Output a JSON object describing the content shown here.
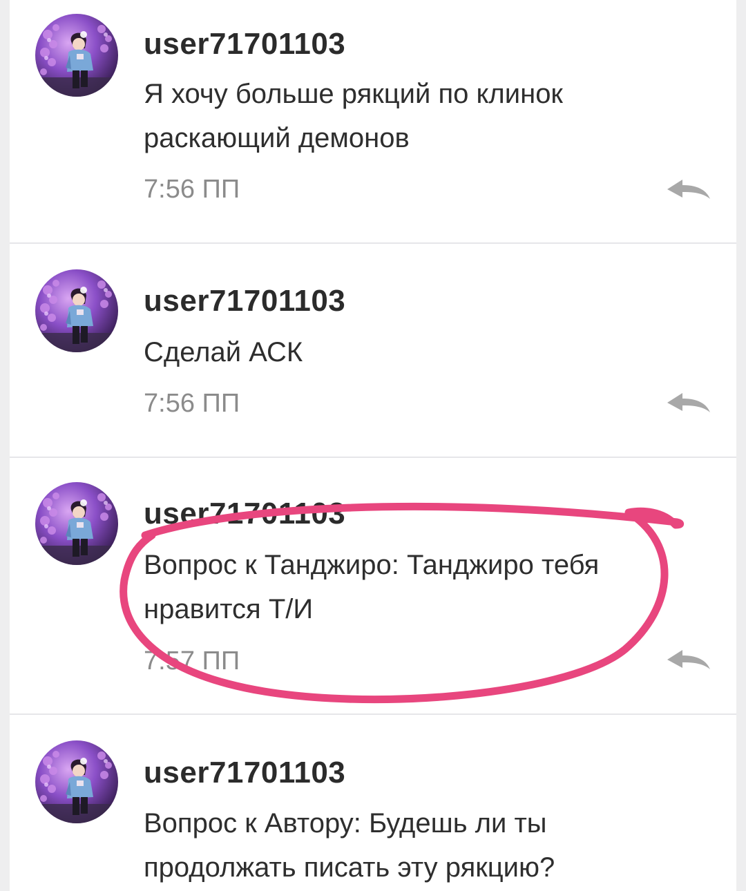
{
  "comments": [
    {
      "username": "user71701103",
      "text": "Я хочу больше рякций по клинок раскающий демонов",
      "time": "7:56 ПП"
    },
    {
      "username": "user71701103",
      "text": "Сделай АСК",
      "time": "7:56 ПП"
    },
    {
      "username": "user71701103",
      "text": "Вопрос к Танджиро: Танджиро тебя нравится Т/И",
      "time": "7:57 ПП"
    },
    {
      "username": "user71701103",
      "text": "Вопрос к Автору: Будешь ли ты продолжать писать эту рякцию?",
      "time": ""
    }
  ],
  "icons": {
    "avatar": "user-avatar-image",
    "reply": "reply-arrow-icon"
  },
  "colors": {
    "annotation": "#e8467e",
    "username": "#2b2b2b",
    "time": "#8b8b8b",
    "reply_icon": "#a8a8a8"
  }
}
